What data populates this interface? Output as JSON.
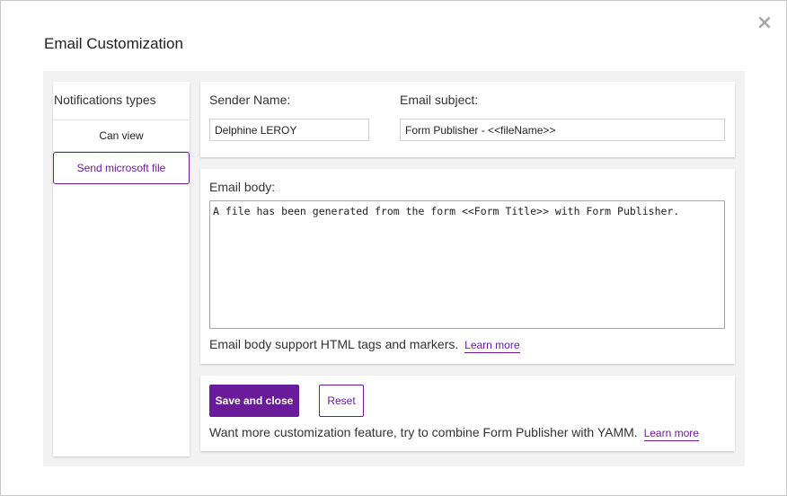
{
  "dialog": {
    "title": "Email Customization",
    "close_glyph": "×",
    "close_icon": "close-icon"
  },
  "notifications": {
    "heading": "Notifications types",
    "items": [
      {
        "label": "Can view",
        "active": false
      },
      {
        "label": "Send microsoft file",
        "active": true
      }
    ]
  },
  "sender": {
    "name_label": "Sender Name:",
    "name_value": "Delphine LEROY",
    "subject_label": "Email subject:",
    "subject_value": "Form Publisher - <<fileName>>"
  },
  "email_body": {
    "label": "Email body:",
    "value": "A file has been generated from the form <<Form Title>> with Form Publisher.",
    "hint": "Email body support HTML tags and markers.",
    "learn_more": "Learn more"
  },
  "actions": {
    "save_label": "Save and close",
    "reset_label": "Reset",
    "promo_text": "Want more customization feature, try to combine Form Publisher with YAMM.",
    "learn_more": "Learn more"
  },
  "colors": {
    "accent": "#6a1b9a",
    "panel_bg": "#f2f2f2"
  }
}
